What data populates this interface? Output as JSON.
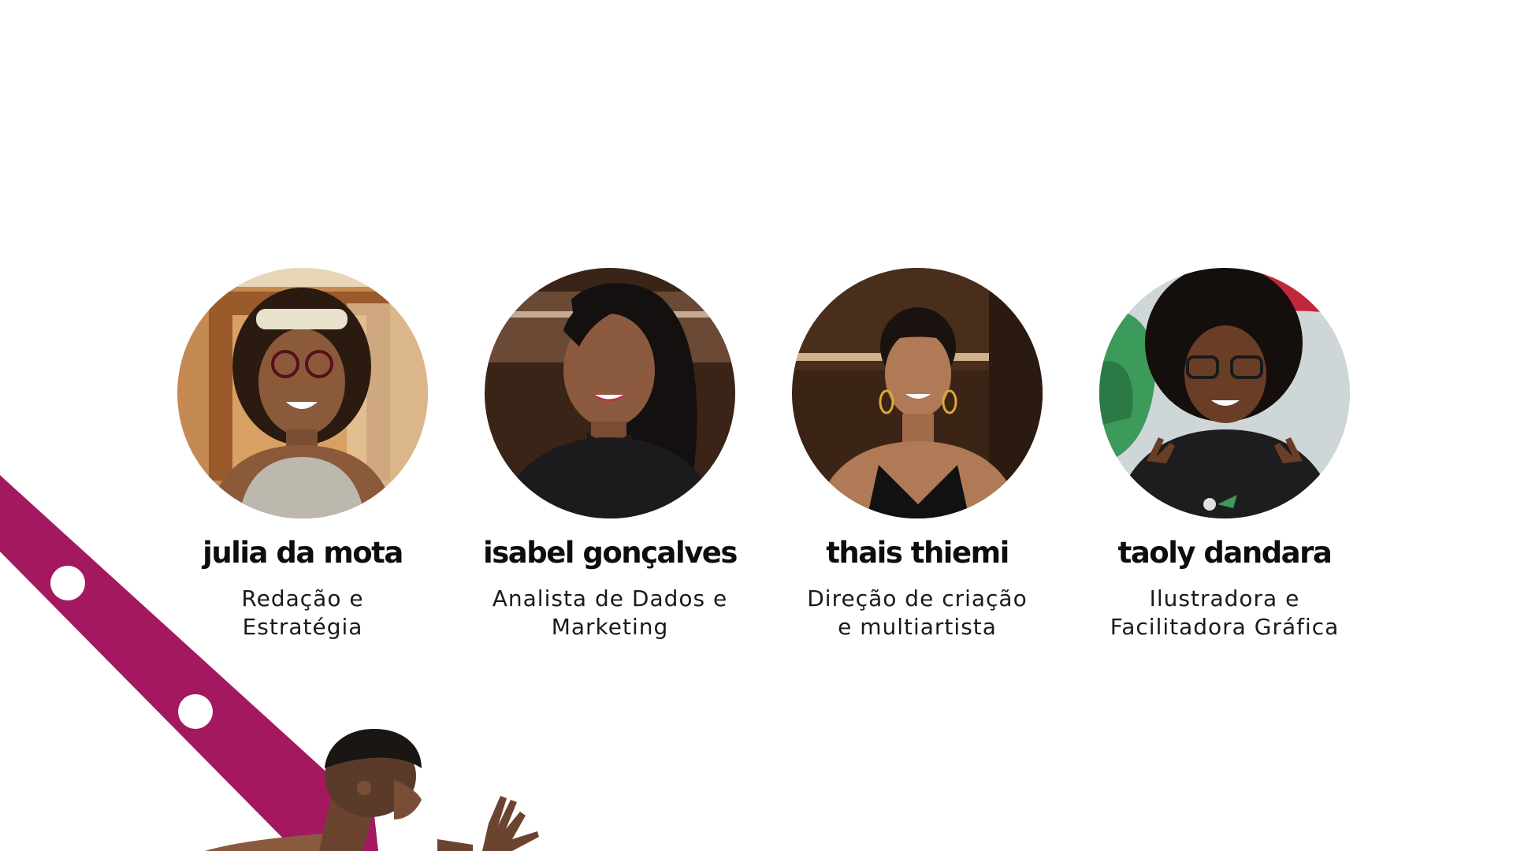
{
  "accent_color": "#a3185f",
  "team": [
    {
      "name": "julia da mota",
      "role_lines": [
        "Redação e",
        "Estratégia"
      ],
      "photo": "portrait-julia",
      "photo_colors": {
        "bg": "#c48a52",
        "bg2": "#e6c9a3",
        "skin": "#8a5a3a",
        "hair": "#2a1a10",
        "shirt": "#bdb8ae"
      }
    },
    {
      "name": "isabel gonçalves",
      "role_lines": [
        "Analista de Dados e",
        "Marketing"
      ],
      "photo": "portrait-isabel",
      "photo_colors": {
        "bg": "#3a2418",
        "bg2": "#6b4a35",
        "skin": "#8c5a3e",
        "hair": "#141010",
        "shirt": "#1b1b1d"
      }
    },
    {
      "name": "thais thiemi",
      "role_lines": [
        "Direção de criação",
        "e multiartista"
      ],
      "photo": "portrait-thais",
      "photo_colors": {
        "bg": "#3b2416",
        "bg2": "#a86a3a",
        "skin": "#b07a56",
        "hair": "#1a120e",
        "shirt": "#111111"
      }
    },
    {
      "name": "taoly dandara",
      "role_lines": [
        "Ilustradora e",
        "Facilitadora Gráfica"
      ],
      "photo": "portrait-taoly",
      "photo_colors": {
        "bg": "#cfd6d8",
        "bg2": "#3c9a5a",
        "accent": "#c0283a",
        "skin": "#6a3e26",
        "hair": "#140e0c",
        "shirt": "#1d1d1f"
      }
    }
  ]
}
